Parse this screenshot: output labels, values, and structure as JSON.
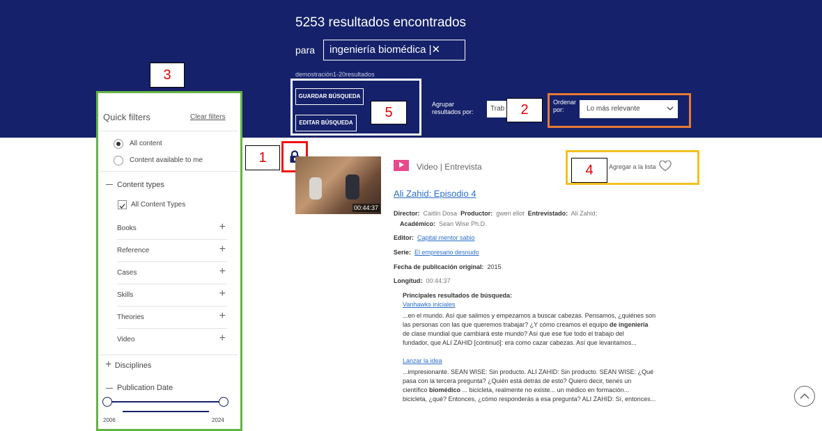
{
  "header": {
    "results_count": "5253 resultados encontrados",
    "para_label": "para",
    "query": "ingeniería biomédica |✕",
    "showing": "demostración1-20resultados",
    "save_search": "GUARDAR BÚSQUEDA",
    "edit_search": "EDITAR BÚSQUEDA",
    "group_label": "Agrupar resultados por:",
    "group_value": "Trab",
    "sort_label": "Ordenar por:",
    "sort_value": "Lo más relevante"
  },
  "callouts": [
    "1",
    "2",
    "3",
    "4",
    "5"
  ],
  "sidebar": {
    "title": "Quick filters",
    "clear": "Clear filters",
    "radio_all": "All content",
    "radio_available": "Content available to me",
    "content_types": "Content types",
    "all_types": "All Content Types",
    "types": [
      "Books",
      "Reference",
      "Cases",
      "Skills",
      "Theories",
      "Video"
    ],
    "disciplines": "Disciplines",
    "publication_date": "Publication Date",
    "year_start": "2006",
    "year_end": "2024"
  },
  "result": {
    "duration_badge": "00:44:37",
    "type_label": "Video | Entrevista",
    "add_to_list": "Agregar a la lista",
    "title": "Ali Zahid: Episodio 4",
    "director_label": "Director:",
    "director": "Caitlin Dosa",
    "producer_label": "Productor:",
    "producer": "gwen ellot",
    "interviewee_label": "Entrevistado:",
    "interviewee": "Ali Zahid;",
    "academic_label": "Académico:",
    "academic": "Sean Wise Ph.D.",
    "editor_label": "Editor:",
    "editor": "Capital mentor sabio",
    "series_label": "Serie:",
    "series": "El empresario desnudo",
    "pubdate_label": "Fecha de publicación original:",
    "pubdate": "2015",
    "length_label": "Longitud:",
    "length": "00:44:37",
    "top_results": "Principales resultados de búsqueda:",
    "snippet1_link": "Vanhawks iniciales",
    "snippet1_l1": "...en el mundo. Así que salimos y empezamos a buscar cabezas. Pensamos, ¿quiénes son",
    "snippet1_l2a": "las personas con las que queremos trabajar? ¿Y cómo creamos el equipo ",
    "snippet1_l2b": "de ingeniería",
    "snippet1_l3": "de clase mundial que cambiará este mundo? Así que ese fue todo el trabajo del",
    "snippet1_l4": "fundador, que ALI ZAHID [continuó]: era como cazar cabezas. Así que levantamos...",
    "snippet2_link": "Lanzar la idea",
    "snippet2_l1": "...impresionante. SEAN WISE: Sin producto. ALI ZAHID: Sin producto. SEAN WISE: ¿Qué",
    "snippet2_l2": "pasa con la tercera pregunta? ¿Quién está detrás de esto? Quiero decir, tienes un",
    "snippet2_l3a": "científico ",
    "snippet2_l3b": "biomédico",
    "snippet2_l3c": " ... bicicleta, realmente no existe... un médico en formación...",
    "snippet2_l4": "bicicleta, ¿qué? Entonces, ¿cómo responderás a esa pregunta? ALI ZAHID: Sí, entonces..."
  },
  "colors": {
    "header_bg": "#15216a",
    "callout_red": "#e00000",
    "sidebar_green": "#66b244",
    "sort_orange": "#e77a34",
    "lock_red": "#ee1111",
    "add_yellow": "#f3c11f",
    "link_blue": "#2a6ec9",
    "video_pink": "#e64a8c"
  }
}
